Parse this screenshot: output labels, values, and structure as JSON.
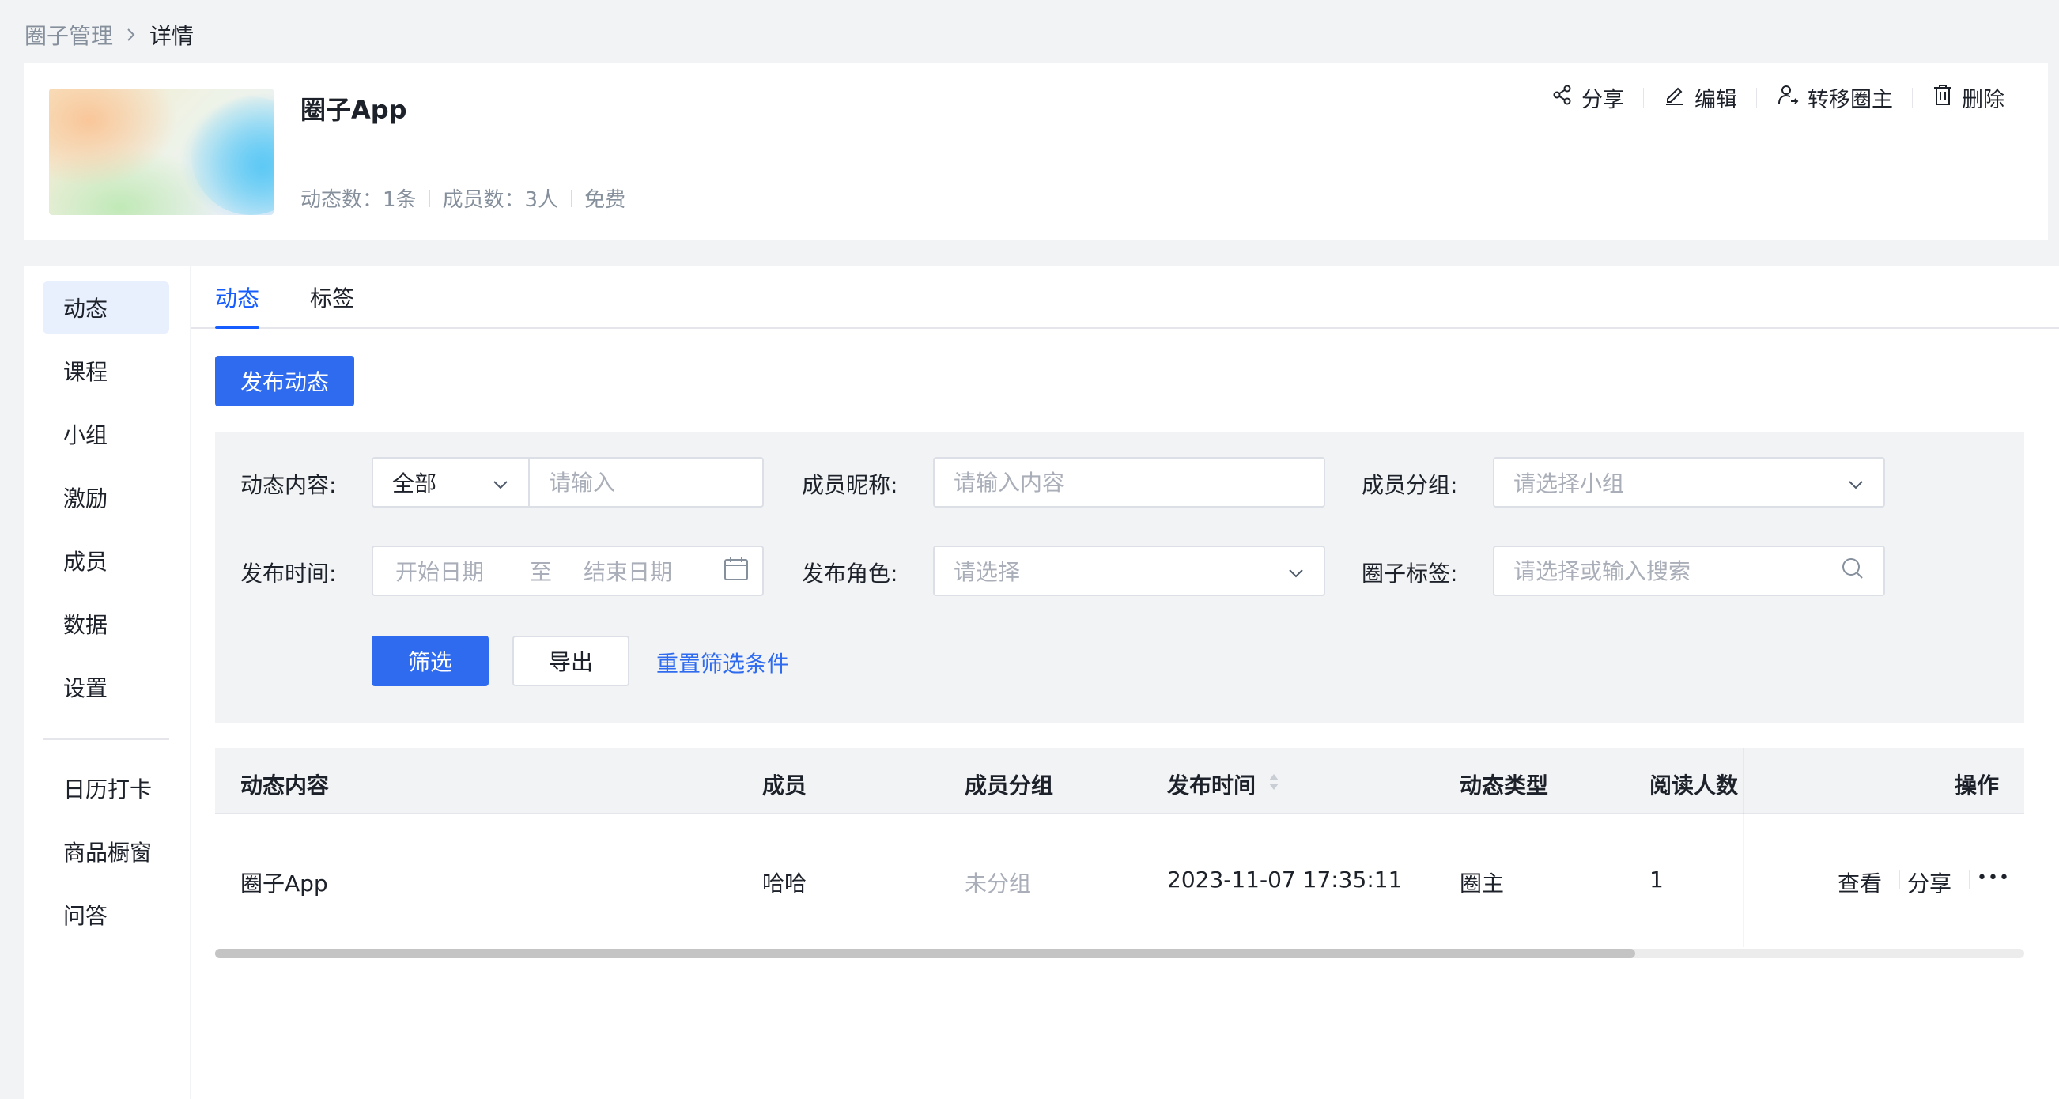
{
  "breadcrumb": {
    "parent": "圈子管理",
    "current": "详情"
  },
  "circle": {
    "title": "圈子App",
    "stats": {
      "posts": "动态数：1条",
      "members": "成员数：3人",
      "price": "免费"
    }
  },
  "header_actions": [
    {
      "label": "分享",
      "icon": "share-icon"
    },
    {
      "label": "编辑",
      "icon": "edit-icon"
    },
    {
      "label": "转移圈主",
      "icon": "transfer-owner-icon"
    },
    {
      "label": "删除",
      "icon": "trash-icon"
    }
  ],
  "sidebar": {
    "items": [
      "动态",
      "课程",
      "小组",
      "激励",
      "成员",
      "数据",
      "设置"
    ],
    "extra_items": [
      "日历打卡",
      "商品橱窗",
      "问答"
    ],
    "active": "动态"
  },
  "tabs": {
    "items": [
      "动态",
      "标签"
    ],
    "active": "动态"
  },
  "publish_button": "发布动态",
  "filters": {
    "content_label": "动态内容:",
    "content_select": "全部",
    "content_placeholder": "请输入",
    "nickname_label": "成员昵称:",
    "nickname_placeholder": "请输入内容",
    "group_label": "成员分组:",
    "group_placeholder": "请选择小组",
    "time_label": "发布时间:",
    "start_placeholder": "开始日期",
    "range_sep": "至",
    "end_placeholder": "结束日期",
    "role_label": "发布角色:",
    "role_placeholder": "请选择",
    "tag_label": "圈子标签:",
    "tag_placeholder": "请选择或输入搜索",
    "filter_button": "筛选",
    "export_button": "导出",
    "reset_link": "重置筛选条件"
  },
  "table": {
    "columns": {
      "content": "动态内容",
      "member": "成员",
      "group": "成员分组",
      "time": "发布时间",
      "type": "动态类型",
      "reads": "阅读人数",
      "ops": "操作"
    },
    "rows": [
      {
        "content": "圈子App",
        "member": "哈哈",
        "group": "未分组",
        "time": "2023-11-07 17:35:11",
        "type": "圈主",
        "reads": "1",
        "view": "查看",
        "share": "分享",
        "more": "•••"
      }
    ]
  },
  "colors": {
    "primary": "#2f6bef",
    "page_bg": "#f2f3f5",
    "muted_text": "#86909c"
  }
}
